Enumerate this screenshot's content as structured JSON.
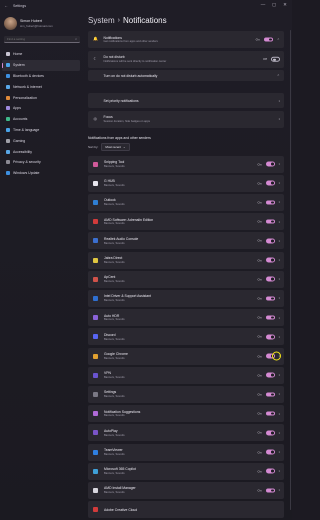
{
  "window": {
    "title": "Settings",
    "minimize": "—",
    "maximize": "▢",
    "close": "✕",
    "back": "←"
  },
  "profile": {
    "name": "Simon Hubert",
    "email": "sim_hubert@hotmail.com"
  },
  "search": {
    "placeholder": "Find a setting",
    "icon": "search-icon"
  },
  "nav": [
    {
      "label": "Home",
      "color": "#c9c5d3",
      "active": false
    },
    {
      "label": "System",
      "color": "#4aa3e8",
      "active": true
    },
    {
      "label": "Bluetooth & devices",
      "color": "#3d8fe0",
      "active": false
    },
    {
      "label": "Network & internet",
      "color": "#59a8e9",
      "active": false
    },
    {
      "label": "Personalization",
      "color": "#e08a3a",
      "active": false
    },
    {
      "label": "Apps",
      "color": "#9f8ae0",
      "active": false
    },
    {
      "label": "Accounts",
      "color": "#3fb98a",
      "active": false
    },
    {
      "label": "Time & language",
      "color": "#4aa3e8",
      "active": false
    },
    {
      "label": "Gaming",
      "color": "#a0a0a8",
      "active": false
    },
    {
      "label": "Accessibility",
      "color": "#5aa7e6",
      "active": false
    },
    {
      "label": "Privacy & security",
      "color": "#8c8a94",
      "active": false
    },
    {
      "label": "Windows Update",
      "color": "#3d8fe0",
      "active": false
    }
  ],
  "breadcrumb": {
    "parent": "System",
    "separator": "›",
    "current": "Notifications"
  },
  "top_settings": [
    {
      "title": "Notifications",
      "sub": "Get notifications from apps and other senders",
      "state": "On",
      "toggle": "on",
      "trail": "expand"
    },
    {
      "title": "Do not disturb",
      "sub": "Notifications will be sent directly to notification center",
      "state": "Off",
      "toggle": "off",
      "trail": "none"
    },
    {
      "title": "Turn on do not disturb automatically",
      "sub": "",
      "state": "",
      "toggle": "",
      "trail": "expand"
    },
    {
      "title": "Set priority notifications",
      "sub": "",
      "state": "",
      "toggle": "",
      "trail": "chevron"
    },
    {
      "title": "Focus",
      "sub": "Session duration, hide badges on apps",
      "state": "",
      "toggle": "",
      "trail": "chevron"
    }
  ],
  "apps_section": {
    "title": "Notifications from apps and other senders",
    "sort_label": "Sort by:",
    "sort_value": "Most recent",
    "apps": [
      {
        "name": "Snipping Tool",
        "sub": "Banners, Sounds",
        "state": "On",
        "color": "#d05a9a"
      },
      {
        "name": "G HUB",
        "sub": "Banners, Sounds",
        "state": "On",
        "color": "#e8e6ee"
      },
      {
        "name": "Outlook",
        "sub": "Banners, Sounds",
        "state": "On",
        "color": "#2f7fd4"
      },
      {
        "name": "AMD Software: Adrenalin Edition",
        "sub": "Banners, Sounds",
        "state": "On",
        "color": "#d23b3b"
      },
      {
        "name": "Realtek Audio Console",
        "sub": "Banners, Sounds",
        "state": "On",
        "color": "#3b6fd0"
      },
      {
        "name": "Jabra Direct",
        "sub": "Banners, Sounds",
        "state": "On",
        "color": "#e0c640"
      },
      {
        "name": "ApCent",
        "sub": "Banners, Sounds",
        "state": "On",
        "color": "#d0524a"
      },
      {
        "name": "Intel Driver & Support Assistant",
        "sub": "Banners, Sounds",
        "state": "On",
        "color": "#2f6fd0"
      },
      {
        "name": "Auto HDR",
        "sub": "Banners, Sounds",
        "state": "On",
        "color": "#8a63d8"
      },
      {
        "name": "Discord",
        "sub": "Banners, Sounds",
        "state": "On",
        "color": "#5865f2"
      },
      {
        "name": "Google Chrome",
        "sub": "Banners, Sounds",
        "state": "On",
        "color": "#e0a030"
      },
      {
        "name": "VPN",
        "sub": "Banners, Sounds",
        "state": "On",
        "color": "#6a54d0"
      },
      {
        "name": "Settings",
        "sub": "Banners, Sounds",
        "state": "On",
        "color": "#7a7884"
      },
      {
        "name": "Notification Suggestions",
        "sub": "Banners, Sounds",
        "state": "On",
        "color": "#b06ad8"
      },
      {
        "name": "AutoPlay",
        "sub": "Banners, Sounds",
        "state": "On",
        "color": "#7a54c8"
      },
      {
        "name": "TeamViewer",
        "sub": "Banners, Sounds",
        "state": "On",
        "color": "#2f7fe0"
      },
      {
        "name": "Microsoft 365 Copilot",
        "sub": "Banners, Sounds",
        "state": "On",
        "color": "#3fa0d8"
      },
      {
        "name": "AMD Install Manager",
        "sub": "Banners, Sounds",
        "state": "On",
        "color": "#d8d6de"
      },
      {
        "name": "Adobe Creative Cloud",
        "sub": "",
        "state": "",
        "color": "#d23b3b"
      }
    ]
  },
  "colors": {
    "accent": "#d48ad2",
    "highlight": "#f5e51a",
    "card": "#2a2830",
    "background": "#1c1a22"
  }
}
